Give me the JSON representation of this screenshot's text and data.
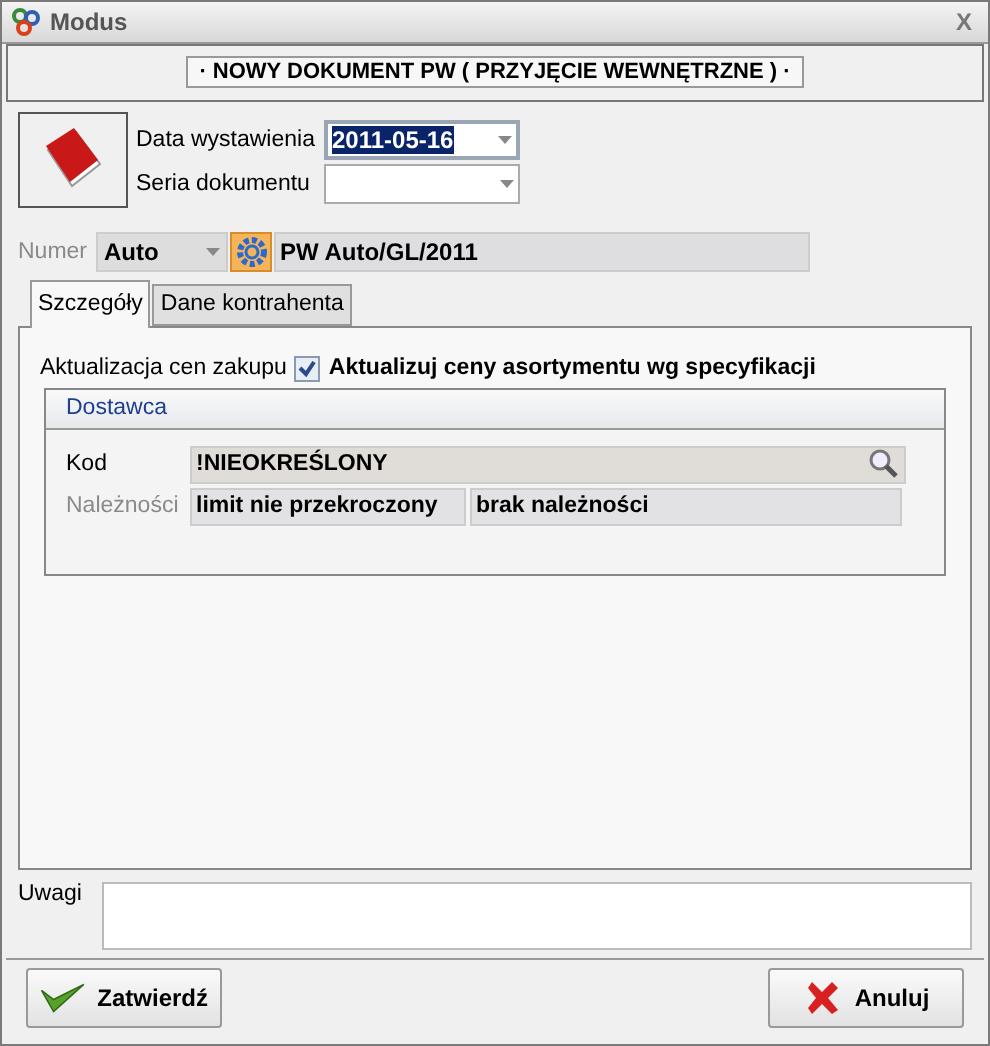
{
  "window": {
    "title": "Modus",
    "close": "X"
  },
  "header": "· NOWY DOKUMENT PW ( PRZYJĘCIE WEWNĘTRZNE ) ·",
  "fields": [
    {
      "label": "Data wystawienia",
      "value": "2011-05-16",
      "highlighted": true
    },
    {
      "label": "Seria dokumentu",
      "highlighted": false
    }
  ],
  "numer": {
    "label": "Numer",
    "mode": "Auto",
    "value": "PW Auto/GL/2011"
  },
  "tabs": [
    {
      "label": "Szczegóły",
      "selected": true
    },
    {
      "label": "Dane kontrahenta",
      "selected": false
    }
  ],
  "price_update": {
    "label": "Aktualizacja cen zakupu",
    "checkbox_label": "Aktualizuj ceny asortymentu wg specyfikacji",
    "checked": true
  },
  "supplier": {
    "title": "Dostawca",
    "code_label": "Kod",
    "code": "!NIEOKREŚLONY",
    "dues_label": "Należności",
    "dues": [
      "limit nie przekroczony",
      "brak należności"
    ]
  },
  "notes": {
    "label": "Uwagi"
  },
  "buttons": [
    {
      "label": "Zatwierdź",
      "kind": "confirm"
    },
    {
      "label": "Anuluj",
      "kind": "cancel"
    }
  ]
}
